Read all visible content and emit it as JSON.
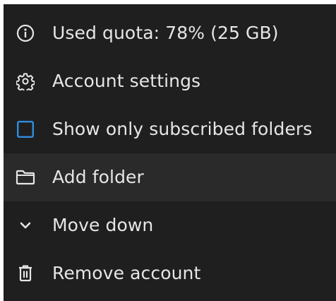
{
  "menu": {
    "items": [
      {
        "label": "Used quota: 78% (25 GB)",
        "icon": "info-icon"
      },
      {
        "label": "Account settings",
        "icon": "gear-icon"
      },
      {
        "label": "Show only subscribed folders",
        "icon": "checkbox-icon",
        "checked": false
      },
      {
        "label": "Add folder",
        "icon": "folder-icon"
      },
      {
        "label": "Move down",
        "icon": "chevron-down-icon"
      },
      {
        "label": "Remove account",
        "icon": "trash-icon"
      }
    ]
  },
  "colors": {
    "background": "#1f1f1f",
    "hover": "#2a2a2a",
    "text": "#e6e6e6",
    "accent": "#2f8ee0"
  }
}
